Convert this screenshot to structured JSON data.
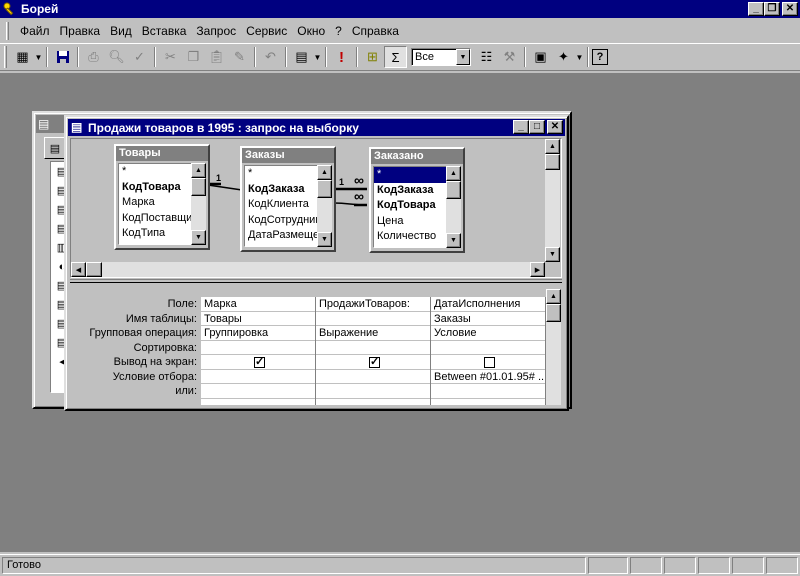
{
  "app": {
    "title": "Борей"
  },
  "menu": {
    "items": [
      "Файл",
      "Правка",
      "Вид",
      "Вставка",
      "Запрос",
      "Сервис",
      "Окно",
      "?",
      "Справка"
    ]
  },
  "toolbar": {
    "values_combo": "Все",
    "icons": [
      "view-icon",
      "save-icon",
      "print-icon",
      "print-preview-icon",
      "spell-check-icon",
      "cut-icon",
      "copy-icon",
      "paste-icon",
      "format-painter-icon",
      "undo-icon",
      "query-type-icon",
      "run-icon",
      "show-table-icon",
      "totals-icon",
      "properties-icon",
      "build-icon",
      "database-window-icon",
      "new-object-icon",
      "help-icon"
    ]
  },
  "query_window": {
    "title": "Продажи товаров в 1995 : запрос на выборку",
    "tables": [
      {
        "name": "Товары",
        "fields": [
          {
            "name": "*",
            "bold": false
          },
          {
            "name": "КодТовара",
            "bold": true
          },
          {
            "name": "Марка",
            "bold": false
          },
          {
            "name": "КодПоставщика",
            "bold": false
          },
          {
            "name": "КодТипа",
            "bold": false
          }
        ]
      },
      {
        "name": "Заказы",
        "fields": [
          {
            "name": "*",
            "bold": false
          },
          {
            "name": "КодЗаказа",
            "bold": true
          },
          {
            "name": "КодКлиента",
            "bold": false
          },
          {
            "name": "КодСотрудника",
            "bold": false
          },
          {
            "name": "ДатаРазмещения",
            "bold": false
          }
        ]
      },
      {
        "name": "Заказано",
        "fields": [
          {
            "name": "*",
            "bold": false,
            "selected": true
          },
          {
            "name": "КодЗаказа",
            "bold": true
          },
          {
            "name": "КодТовара",
            "bold": true
          },
          {
            "name": "Цена",
            "bold": false
          },
          {
            "name": "Количество",
            "bold": false
          }
        ]
      }
    ],
    "relations": [
      {
        "one": "1",
        "many": "∞"
      },
      {
        "one": "1",
        "many": "∞"
      }
    ],
    "grid": {
      "row_labels": [
        "Поле:",
        "Имя таблицы:",
        "Групповая операция:",
        "Сортировка:",
        "Вывод на экран:",
        "Условие отбора:",
        "или:"
      ],
      "columns": [
        {
          "field": "Марка",
          "table": "Товары",
          "total": "Группировка",
          "sort": "",
          "show": true,
          "criteria": "",
          "or": ""
        },
        {
          "field": "ПродажиТоваров:",
          "table": "",
          "total": "Выражение",
          "sort": "",
          "show": true,
          "criteria": "",
          "or": ""
        },
        {
          "field": "ДатаИсполнения",
          "table": "Заказы",
          "total": "Условие",
          "sort": "",
          "show": false,
          "criteria": "Between #01.01.95# ...",
          "or": ""
        }
      ]
    }
  },
  "status": {
    "text": "Готово"
  }
}
